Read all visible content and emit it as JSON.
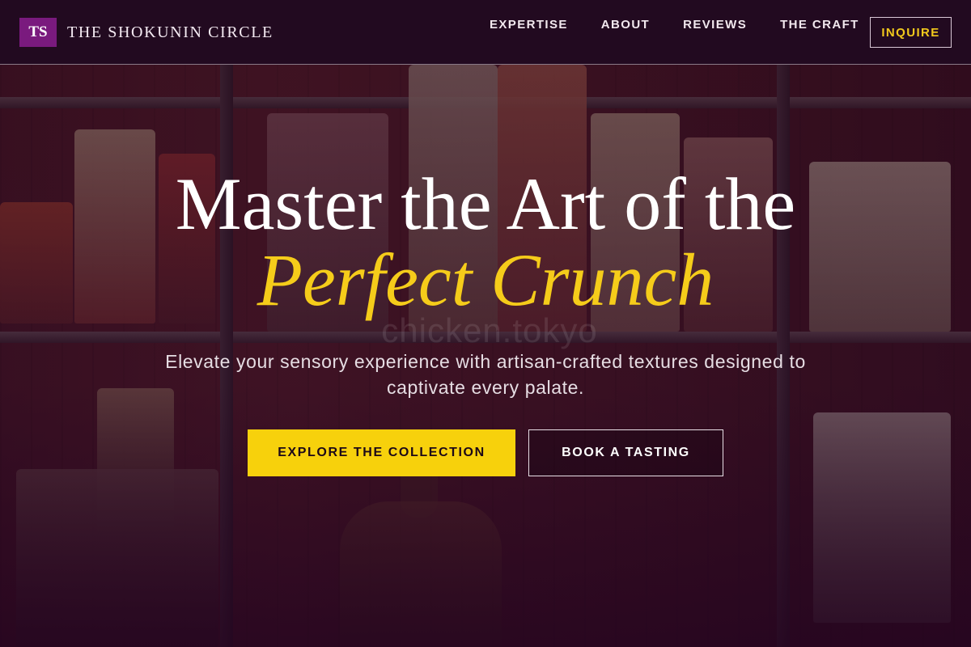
{
  "header": {
    "logo_initials": "TS",
    "brand_name": "THE SHOKUNIN CIRCLE",
    "nav": [
      {
        "label": "EXPERTISE"
      },
      {
        "label": "ABOUT"
      },
      {
        "label": "REVIEWS"
      },
      {
        "label": "THE CRAFT"
      }
    ],
    "inquire_label": "INQUIRE"
  },
  "hero": {
    "headline_line1": "Master the Art of the",
    "headline_line2": "Perfect Crunch",
    "subtitle": "Elevate your sensory experience with artisan-crafted textures designed to captivate every palate.",
    "primary_cta": "EXPLORE THE COLLECTION",
    "secondary_cta": "BOOK A TASTING",
    "watermark": "chicken.tokyo"
  },
  "colors": {
    "header_bg": "#220a20",
    "logo_bg": "#7a1a7e",
    "accent_yellow": "#f7d10c",
    "text_light": "#ffffff"
  }
}
